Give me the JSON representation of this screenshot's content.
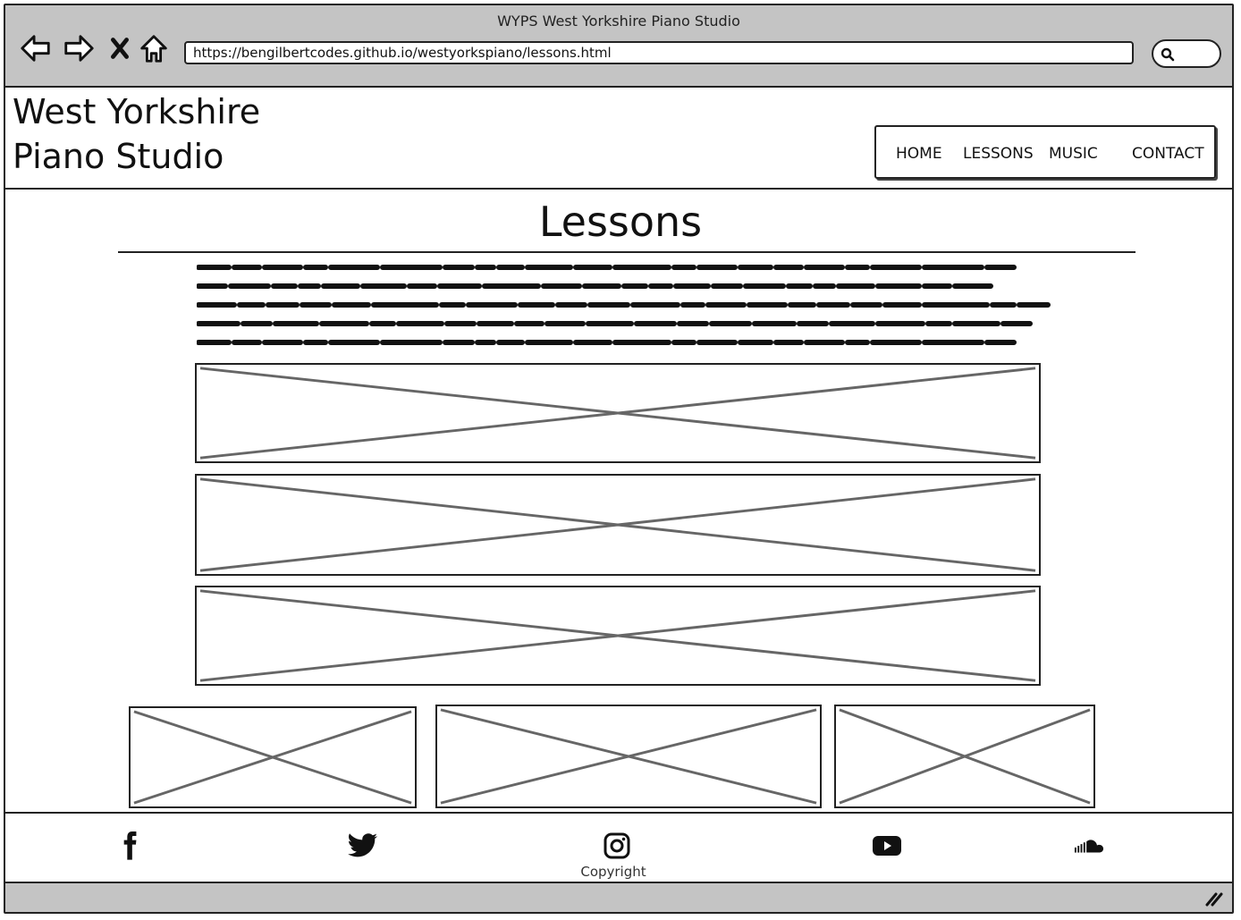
{
  "browser": {
    "window_title": "WYPS West Yorkshire Piano Studio",
    "url": "https://bengilbertcodes.github.io/westyorkspiano/lessons.html",
    "nav_icons": [
      "back-arrow-icon",
      "forward-arrow-icon",
      "close-icon",
      "home-icon"
    ],
    "search_icon": "search-icon"
  },
  "site": {
    "brand_line1": "West Yorkshire",
    "brand_line2": "Piano Studio",
    "nav": [
      "HOME",
      "LESSONS",
      "MUSIC",
      "CONTACT"
    ]
  },
  "main": {
    "title": "Lessons",
    "body_text_lines": 5,
    "image_placeholders_wide": 3,
    "image_placeholders_row": 3
  },
  "footer": {
    "social_icons": [
      "facebook-icon",
      "twitter-icon",
      "instagram-icon",
      "youtube-icon",
      "soundcloud-icon"
    ],
    "copyright": "Copyright"
  }
}
